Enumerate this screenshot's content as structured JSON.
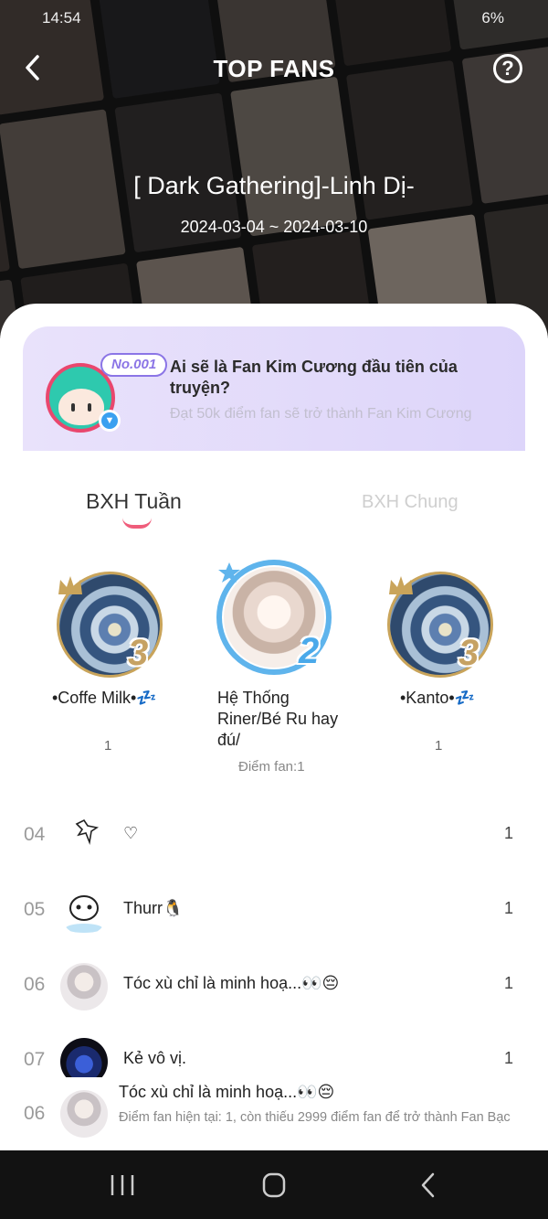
{
  "status": {
    "time": "14:54",
    "battery": "6%"
  },
  "header": {
    "title": "TOP FANS",
    "help_label": "?"
  },
  "comic": {
    "name": "[ Dark Gathering]-Linh Dị-",
    "date_range": "2024-03-04 ~ 2024-03-10"
  },
  "promo": {
    "badge": "No.001",
    "title": "Ai sẽ là Fan Kim Cương đầu tiên của truyện?",
    "subtitle": "Đạt 50k điểm fan sẽ trở thành Fan Kim Cương"
  },
  "tabs": [
    {
      "label": "BXH Tuần"
    },
    {
      "label": "BXH Chung"
    }
  ],
  "podium": [
    {
      "rank": "3",
      "name": "•Coffe Milk•💤",
      "score": "1"
    },
    {
      "rank": "2",
      "name": "Hệ Thống Riner/Bé Ru hay đú/",
      "score": "",
      "points": "Điểm fan:1"
    },
    {
      "rank": "3",
      "name": "•Kanto•💤",
      "score": "1"
    }
  ],
  "list": [
    {
      "rank": "04",
      "name": "♡",
      "score": "1"
    },
    {
      "rank": "05",
      "name": "Thurr🐧",
      "score": "1"
    },
    {
      "rank": "06",
      "name": "Tóc xù chỉ là minh hoạ...👀😔",
      "score": "1"
    },
    {
      "rank": "07",
      "name": "Kẻ vô vị.",
      "score": "1"
    }
  ],
  "me": {
    "rank": "06",
    "name": "Tóc xù chỉ là minh hoạ...👀😔",
    "message": "Điểm fan hiện tại: 1, còn thiếu 2999 điểm fan để trở thành Fan Bạc"
  },
  "colors": {
    "accent": "#ef5d7b",
    "gold": "#c6a263",
    "silver_blue": "#4aa9ea",
    "promo_bg": "#e6def9"
  }
}
